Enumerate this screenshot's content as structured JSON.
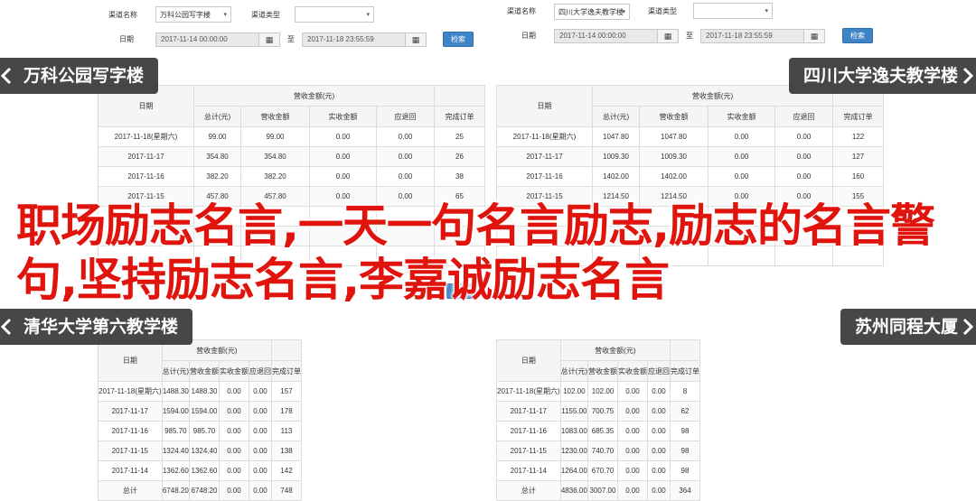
{
  "filter": {
    "channel_label": "渠道名称",
    "type_label": "渠道类型",
    "date_label": "日期",
    "to_label": "至",
    "start_date": "2017-11-14 00:00:00",
    "end_date": "2017-11-18 23:55:59",
    "calendar_glyph": "▦",
    "query_btn": "检索",
    "arrow": "▾"
  },
  "table": {
    "group_header": "营收金额(元)",
    "col_date": "日期",
    "col_total": "总计(元)",
    "col_revenue": "营收金额",
    "col_actual": "实收金额",
    "col_refund": "应退回",
    "col_orders": "完成订单"
  },
  "panels": [
    {
      "channel": "万科公园写字楼",
      "rows": [
        [
          "2017-11-18(星期六)",
          "99.00",
          "99.00",
          "0.00",
          "0.00",
          "25"
        ],
        [
          "2017-11-17",
          "354.80",
          "354.80",
          "0.00",
          "0.00",
          "26"
        ],
        [
          "2017-11-16",
          "382.20",
          "382.20",
          "0.00",
          "0.00",
          "38"
        ],
        [
          "2017-11-15",
          "457.80",
          "457.80",
          "0.00",
          "0.00",
          "65"
        ],
        [
          "",
          "",
          "",
          "",
          "",
          ""
        ],
        [
          "",
          "",
          "",
          "",
          "",
          ""
        ],
        [
          "",
          "",
          "",
          "",
          "",
          ""
        ]
      ]
    },
    {
      "channel": "四川大学逸夫教学楼",
      "rows": [
        [
          "2017-11-18(星期六)",
          "1047.80",
          "1047.80",
          "0.00",
          "0.00",
          "122"
        ],
        [
          "2017-11-17",
          "1009.30",
          "1009.30",
          "0.00",
          "0.00",
          "127"
        ],
        [
          "2017-11-16",
          "1402.00",
          "1402.00",
          "0.00",
          "0.00",
          "160"
        ],
        [
          "2017-11-15",
          "1214.50",
          "1214.50",
          "0.00",
          "0.00",
          "155"
        ],
        [
          "",
          "",
          "",
          "",
          "",
          ""
        ],
        [
          "",
          "",
          "",
          "",
          "",
          ""
        ],
        [
          "",
          "",
          "",
          "",
          "",
          ""
        ]
      ]
    },
    {
      "channel": "清华大学第六教学楼",
      "rows": [
        [
          "2017-11-18(星期六)",
          "1488.30",
          "1488.30",
          "0.00",
          "0.00",
          "157"
        ],
        [
          "2017-11-17",
          "1594.00",
          "1594.00",
          "0.00",
          "0.00",
          "178"
        ],
        [
          "2017-11-16",
          "985.70",
          "985.70",
          "0.00",
          "0.00",
          "113"
        ],
        [
          "2017-11-15",
          "1324.40",
          "1324.40",
          "0.00",
          "0.00",
          "138"
        ],
        [
          "2017-11-14",
          "1362.60",
          "1362.60",
          "0.00",
          "0.00",
          "142"
        ],
        [
          "总计",
          "6748.20",
          "6748.20",
          "0.00",
          "0.00",
          "748"
        ]
      ]
    },
    {
      "channel": "苏州同程大厦",
      "rows": [
        [
          "2017-11-18(星期六)",
          "102.00",
          "102.00",
          "0.00",
          "0.00",
          "8"
        ],
        [
          "2017-11-17",
          "1155.00",
          "700.75",
          "0.00",
          "0.00",
          "62"
        ],
        [
          "2017-11-16",
          "1083.00",
          "685.35",
          "0.00",
          "0.00",
          "98"
        ],
        [
          "2017-11-15",
          "1230.00",
          "740.70",
          "0.00",
          "0.00",
          "98"
        ],
        [
          "2017-11-14",
          "1264.00",
          "670.70",
          "0.00",
          "0.00",
          "98"
        ],
        [
          "总计",
          "4836.00",
          "3007.00",
          "0.00",
          "0.00",
          "364"
        ]
      ]
    }
  ],
  "banners": [
    "万科公园写字楼",
    "四川大学逸夫教学楼",
    "清华大学第六教学楼",
    "苏州同程大厦"
  ],
  "headline": "职场励志名言,一天一句名言励志,励志的名言警句,坚持励志名言,李嘉诚励志名言",
  "colors": {
    "headline": "#e0140c",
    "button": "#3f84c7",
    "banner_bg": "#2d2d2d"
  }
}
